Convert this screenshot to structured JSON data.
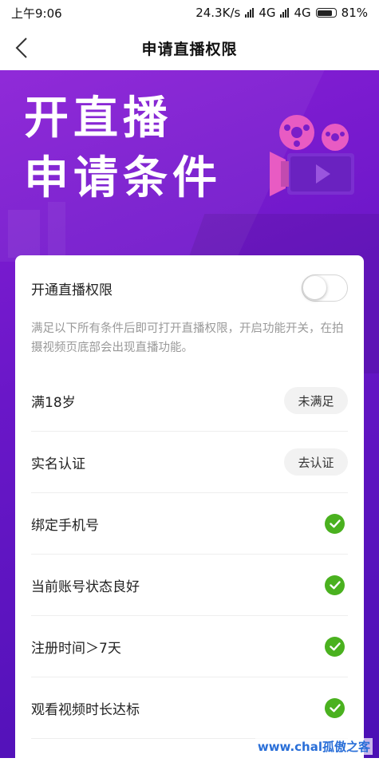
{
  "status_bar": {
    "time": "上午9:06",
    "speed": "24.3K/s",
    "net1": "4G",
    "net2": "4G",
    "battery": "81%"
  },
  "nav": {
    "title": "申请直播权限",
    "back_icon": "chevron-left-icon"
  },
  "banner": {
    "line1": "开直播",
    "line2": "申请条件",
    "icon": "movie-camera-icon",
    "colors": {
      "start": "#8a1fd6",
      "end": "#4b10b4",
      "reel": "#e85bc3"
    }
  },
  "permission": {
    "label": "开通直播权限",
    "enabled": false,
    "description": "满足以下所有条件后即可打开直播权限，开启功能开关，在拍摄视频页底部会出现直播功能。"
  },
  "conditions": [
    {
      "label": "满18岁",
      "status": "未满足",
      "type": "button"
    },
    {
      "label": "实名认证",
      "status": "去认证",
      "type": "button"
    },
    {
      "label": "绑定手机号",
      "status": "",
      "type": "check"
    },
    {
      "label": "当前账号状态良好",
      "status": "",
      "type": "check"
    },
    {
      "label": "注册时间＞7天",
      "status": "",
      "type": "check"
    },
    {
      "label": "观看视频时长达标",
      "status": "",
      "type": "check"
    }
  ],
  "check_color": "#4ab11f",
  "watermark": "www.chal孤傲之客"
}
